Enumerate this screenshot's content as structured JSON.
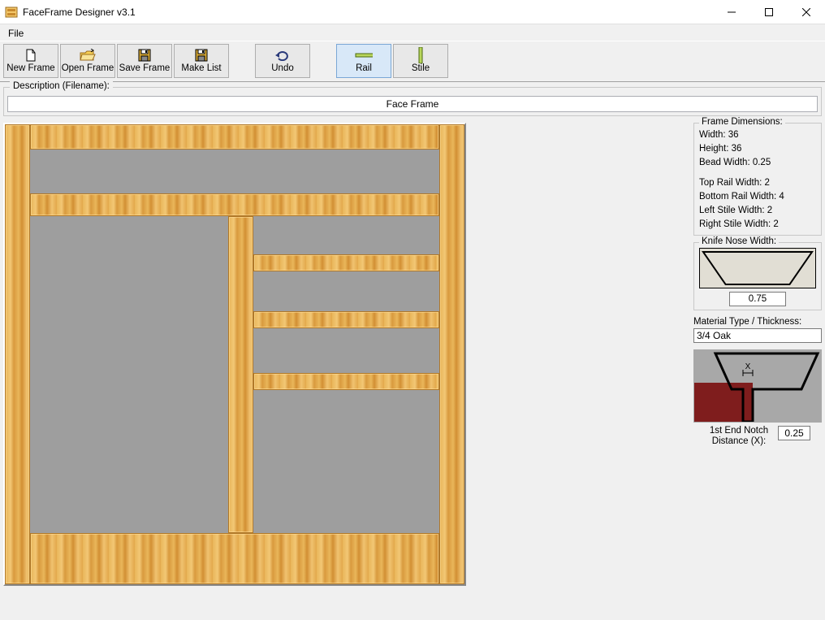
{
  "title": "FaceFrame Designer   v3.1",
  "menu": {
    "file": "File"
  },
  "toolbar": {
    "new_frame": "New Frame",
    "open_frame": "Open Frame",
    "save_frame": "Save Frame",
    "make_list": "Make List",
    "undo": "Undo",
    "rail": "Rail",
    "stile": "Stile"
  },
  "description": {
    "legend": "Description (Filename):",
    "value": "Face Frame"
  },
  "dimensions": {
    "legend": "Frame Dimensions:",
    "width_label": "Width: 36",
    "height_label": "Height: 36",
    "bead_label": "Bead Width: 0.25",
    "top_rail": "Top Rail Width: 2",
    "bottom_rail": "Bottom Rail Width: 4",
    "left_stile": "Left Stile Width: 2",
    "right_stile": "Right Stile Width: 2"
  },
  "knife": {
    "legend": "Knife Nose Width:",
    "value": "0.75"
  },
  "material": {
    "label": "Material Type / Thickness:",
    "value": "3/4 Oak"
  },
  "notch": {
    "label": "1st End Notch Distance (X):",
    "value": "0.25",
    "x_letter": "X"
  }
}
